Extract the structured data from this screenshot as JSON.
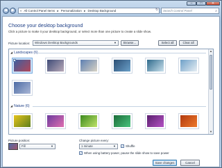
{
  "window": {
    "controls": {
      "minimize": "–",
      "maximize": "□",
      "close": "✕"
    }
  },
  "nav": {
    "back_icon": "◀",
    "forward_icon": "▶",
    "breadcrumb": [
      "«",
      "All Control Panel Items",
      "▸",
      "Personalization",
      "▸",
      "Desktop Background"
    ],
    "search_placeholder": "Search Control Panel"
  },
  "page": {
    "title": "Choose your desktop background",
    "subtitle": "Click a picture to make it your desktop background, or select more than one picture to create a slide show."
  },
  "location": {
    "label": "Picture location:",
    "value": "Windows Desktop Backgrounds",
    "browse": "Browse...",
    "select_all": "Select all",
    "clear_all": "Clear all"
  },
  "gallery": {
    "groups": [
      {
        "name": "Landscapes (6)",
        "images": [
          {
            "checked": true,
            "selected": true,
            "colors": [
              "#3b5fa0",
              "#b3475a"
            ]
          },
          {
            "checked": false,
            "selected": false,
            "colors": [
              "#3f4c78",
              "#b8a9b8"
            ]
          },
          {
            "checked": false,
            "selected": false,
            "colors": [
              "#5d7fb2",
              "#d8d3c4"
            ]
          },
          {
            "checked": false,
            "selected": false,
            "colors": [
              "#2c4f75",
              "#6aa0c8"
            ]
          },
          {
            "checked": false,
            "selected": false,
            "colors": [
              "#2f6a8c",
              "#c9e0ec"
            ]
          },
          {
            "checked": false,
            "selected": false,
            "colors": [
              "#6ea0c8",
              "#e6eef3"
            ]
          }
        ],
        "extra": {
          "checked": false,
          "selected": false,
          "colors": [
            "#4d6ca5",
            "#aab7d6"
          ]
        }
      },
      {
        "name": "Nature (6)",
        "images": [
          {
            "checked": false,
            "selected": false,
            "colors": [
              "#e6c41d",
              "#5c7f1b"
            ]
          },
          {
            "checked": false,
            "selected": false,
            "colors": [
              "#6c3b9e",
              "#e06fb0"
            ]
          },
          {
            "checked": false,
            "selected": false,
            "colors": [
              "#3c8a1e",
              "#bfe36a"
            ]
          },
          {
            "checked": false,
            "selected": false,
            "colors": [
              "#1b6c3a",
              "#48c27c"
            ]
          },
          {
            "checked": false,
            "selected": false,
            "colors": [
              "#5a1f6e",
              "#b452c4"
            ]
          },
          {
            "checked": false,
            "selected": false,
            "colors": [
              "#b23a0e",
              "#ee7a2c"
            ]
          }
        ]
      }
    ]
  },
  "position": {
    "label": "Picture position:",
    "value": "Fill"
  },
  "slideshow": {
    "label": "Change picture every:",
    "value": "1 minute",
    "shuffle_label": "Shuffle",
    "shuffle_checked": true,
    "battery_label": "When using battery power, pause the slide show to save power",
    "battery_checked": true
  },
  "footer": {
    "save": "Save changes",
    "cancel": "Cancel"
  }
}
